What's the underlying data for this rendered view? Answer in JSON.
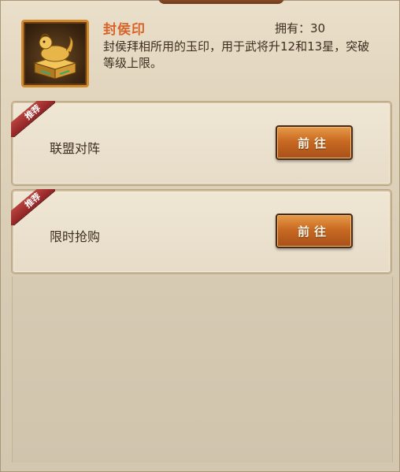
{
  "item": {
    "name": "封侯印",
    "owned_label": "拥有：30",
    "description": "封侯拜相所用的玉印，用于武将升12和13星，突破等级上限。",
    "icon": "jade-seal-icon"
  },
  "sources": [
    {
      "badge": "推荐",
      "label": "联盟对阵",
      "button": "前往"
    },
    {
      "badge": "推荐",
      "label": "限时抢购",
      "button": "前往"
    }
  ]
}
